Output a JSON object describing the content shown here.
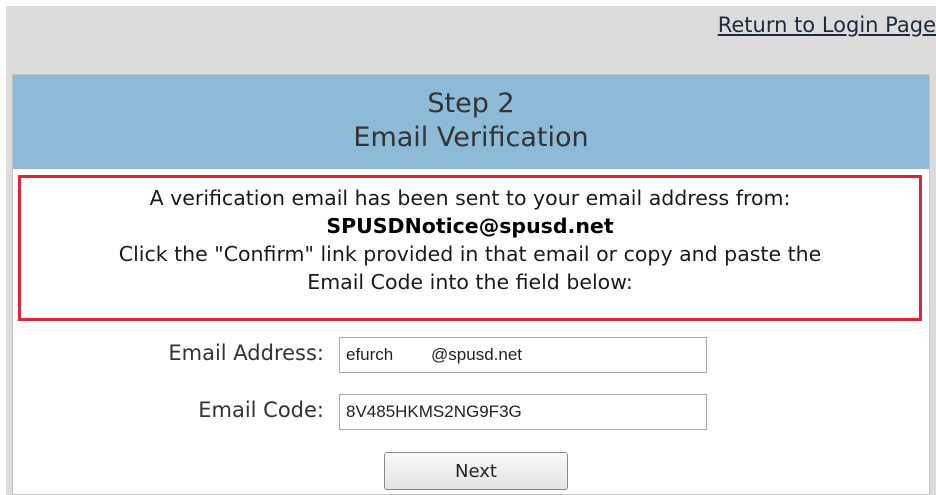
{
  "nav": {
    "return_link": "Return to Login Page"
  },
  "header": {
    "step": "Step 2",
    "title": "Email Verification"
  },
  "notice": {
    "line1": "A verification email has been sent to your email address from:",
    "sender": "SPUSDNotice@spusd.net",
    "line2": "Click the \"Confirm\" link provided in that email or copy and paste the",
    "line3": "Email Code into the field below:"
  },
  "form": {
    "email_label": "Email Address:",
    "email_value": "efurch        @spusd.net",
    "code_label": "Email Code:",
    "code_value": "8V485HKMS2NG9F3G",
    "next_label": "Next"
  },
  "colors": {
    "header_bg": "#8cbad7",
    "notice_border": "#e52231",
    "page_bg": "#dcdcdc"
  }
}
